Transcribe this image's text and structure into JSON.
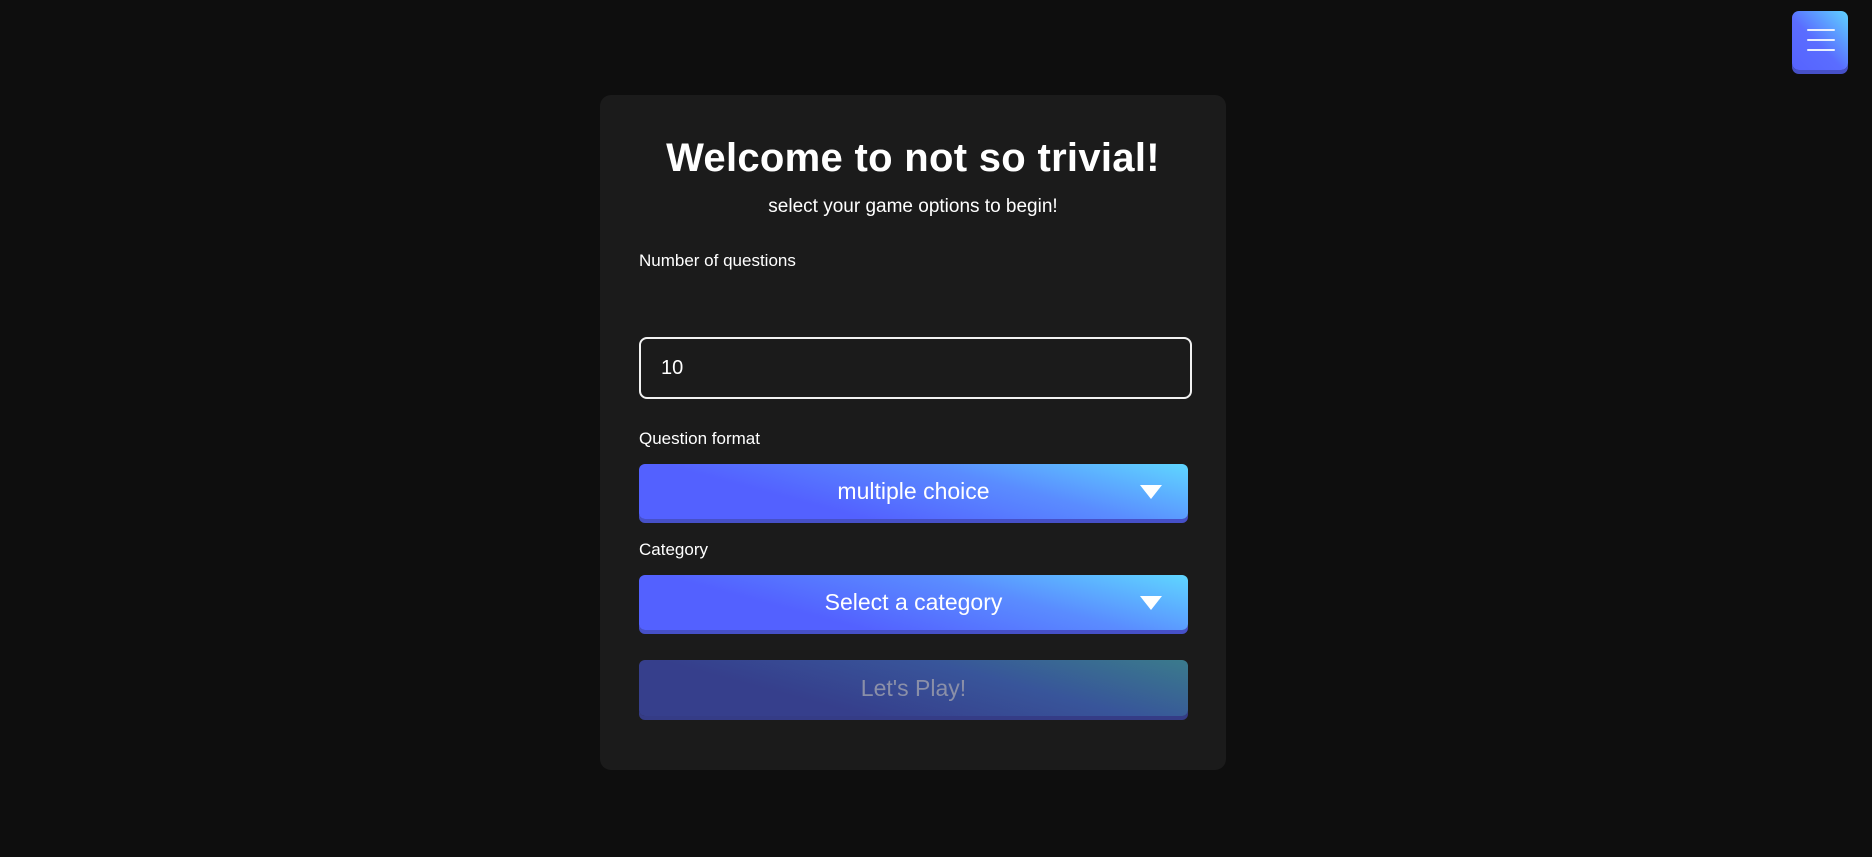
{
  "menu": {
    "icon": "hamburger-menu-icon"
  },
  "card": {
    "title": "Welcome to not so trivial!",
    "subtitle": "select your game options to begin!"
  },
  "form": {
    "num_questions_label": "Number of questions",
    "num_questions_value": "10",
    "format_label": "Question format",
    "format_value": "multiple choice",
    "category_label": "Category",
    "category_value": "Select a category",
    "play_label": "Let's Play!"
  },
  "colors": {
    "background": "#0e0e0e",
    "card": "#1b1b1b",
    "accent_start": "#5361ff",
    "accent_end": "#5fd6ff"
  }
}
